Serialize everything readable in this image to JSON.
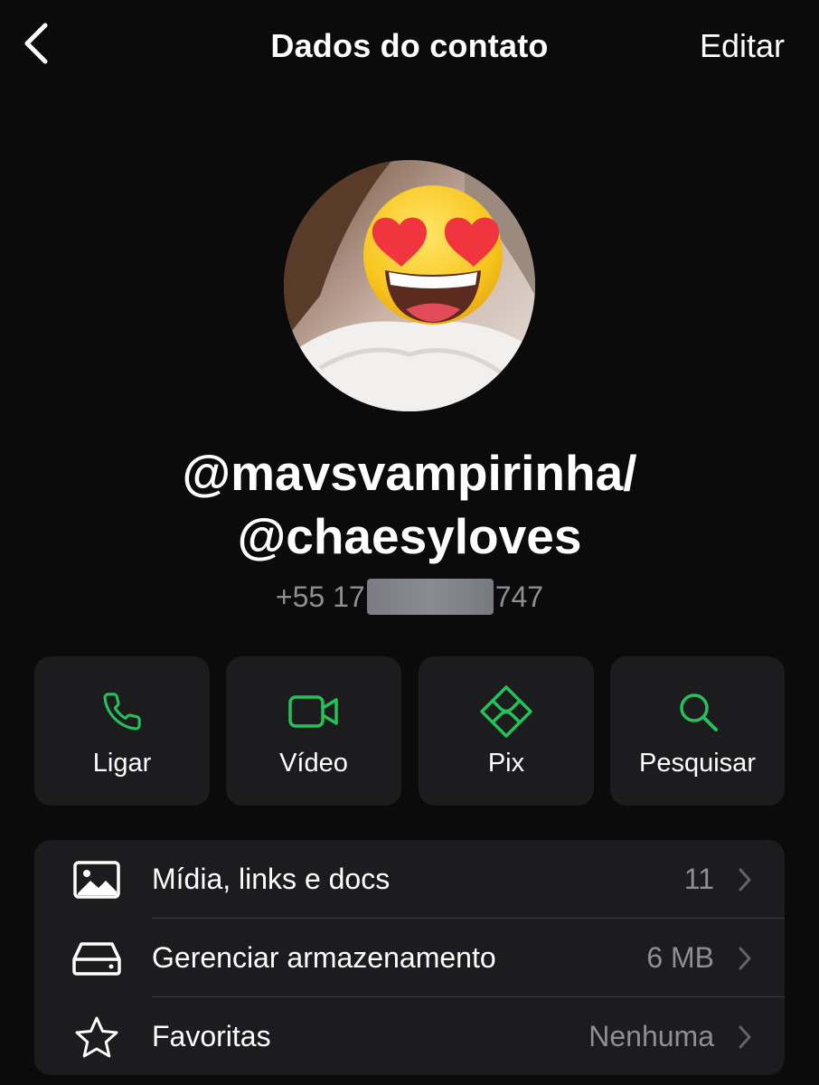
{
  "header": {
    "title": "Dados do contato",
    "edit_label": "Editar",
    "back_icon": "chevron-left-icon"
  },
  "profile": {
    "name_line1": "@mavsvampirinha/",
    "name_line2": "@chaesyloves",
    "phone_prefix": "+55 17",
    "phone_suffix": "747"
  },
  "actions": [
    {
      "label": "Ligar",
      "icon": "phone-icon"
    },
    {
      "label": "Vídeo",
      "icon": "video-camera-icon"
    },
    {
      "label": "Pix",
      "icon": "pix-icon"
    },
    {
      "label": "Pesquisar",
      "icon": "search-icon"
    }
  ],
  "list": [
    {
      "label": "Mídia, links e docs",
      "value": "11",
      "icon": "photo-icon"
    },
    {
      "label": "Gerenciar armazenamento",
      "value": "6 MB",
      "icon": "storage-drive-icon"
    },
    {
      "label": "Favoritas",
      "value": "Nenhuma",
      "icon": "star-icon"
    }
  ],
  "colors": {
    "background": "#0b0b0b",
    "card": "#1c1c1e",
    "accent_green": "#25c15a",
    "secondary_text": "#8e8e93"
  }
}
